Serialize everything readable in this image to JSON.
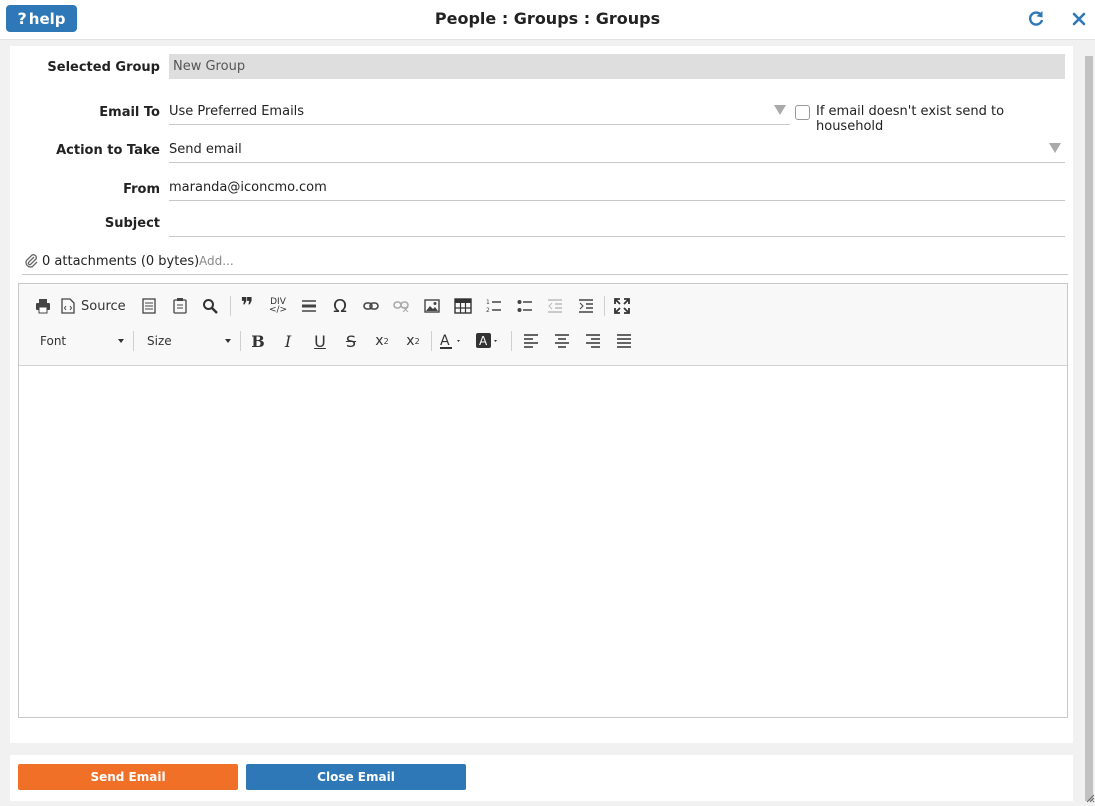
{
  "header": {
    "help_label": "help",
    "title": "People : Groups : Groups",
    "refresh_icon": "refresh-icon",
    "close_icon": "close-icon"
  },
  "form": {
    "selected_group": {
      "label": "Selected Group",
      "value": "New Group"
    },
    "email_to": {
      "label": "Email To",
      "value": "Use Preferred Emails"
    },
    "household_option": {
      "label": "If email doesn't exist send to household",
      "checked": false
    },
    "action": {
      "label": "Action to Take",
      "value": "Send email"
    },
    "from": {
      "label": "From",
      "value": "maranda@iconcmo.com"
    },
    "subject": {
      "label": "Subject",
      "value": ""
    }
  },
  "attachments": {
    "summary": "0 attachments (0 bytes)",
    "add_label": "Add..."
  },
  "editor": {
    "source_label": "Source",
    "font_label": "Font",
    "size_label": "Size",
    "body": ""
  },
  "footer": {
    "send_label": "Send Email",
    "close_label": "Close Email"
  },
  "colors": {
    "primary": "#2e78b8",
    "send": "#f07027",
    "readonly_bg": "#dedede"
  }
}
